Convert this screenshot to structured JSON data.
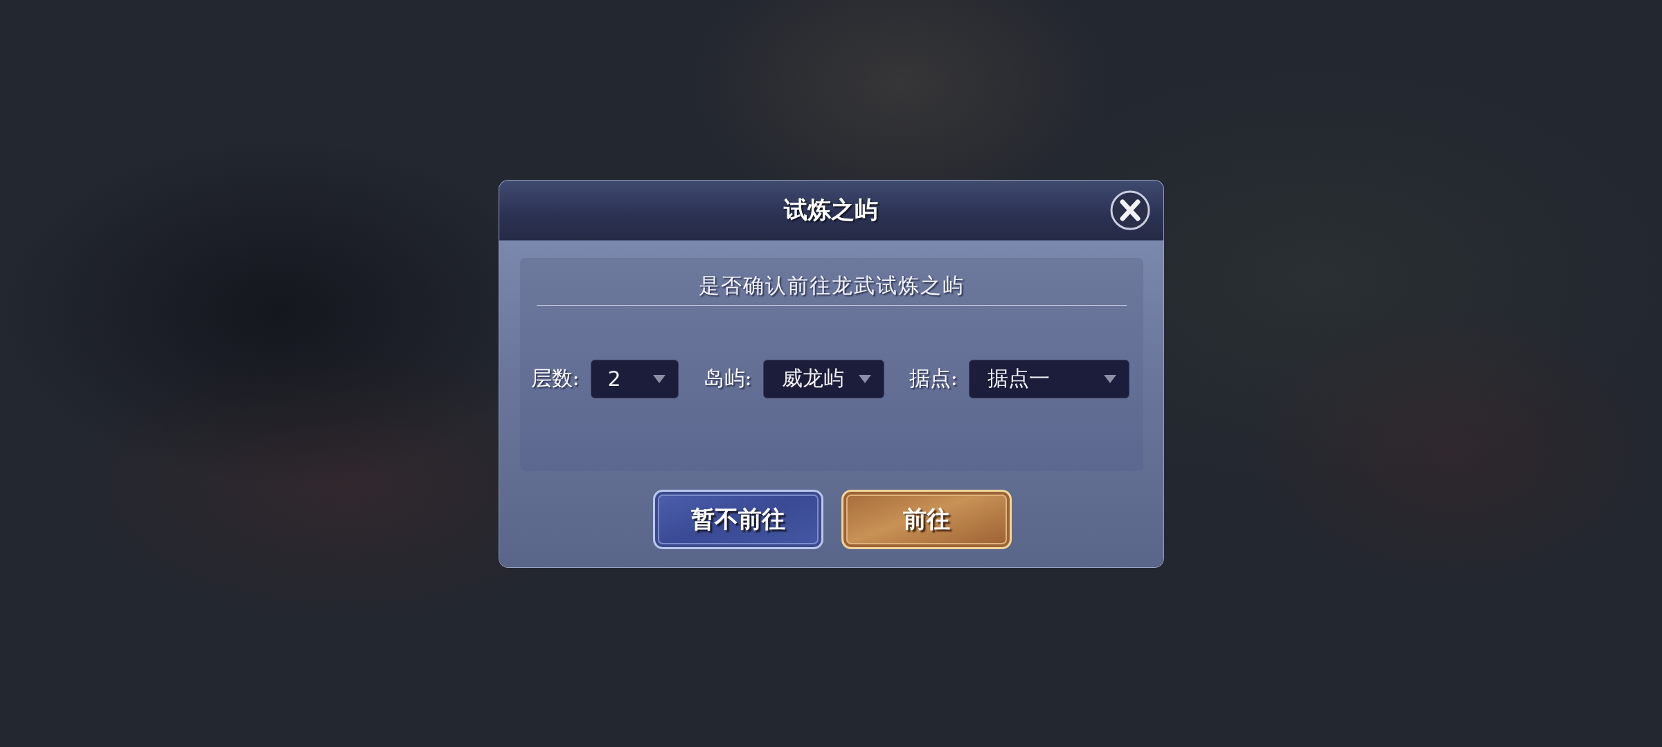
{
  "dialog": {
    "title": "试炼之屿",
    "prompt": "是否确认前往龙武试炼之屿",
    "selectors": [
      {
        "label": "层数:",
        "value": "2"
      },
      {
        "label": "岛屿:",
        "value": "威龙屿"
      },
      {
        "label": "据点:",
        "value": "据点一"
      }
    ],
    "buttons": [
      {
        "label": "暂不前往",
        "kind": "secondary"
      },
      {
        "label": "前往",
        "kind": "primary"
      }
    ]
  }
}
